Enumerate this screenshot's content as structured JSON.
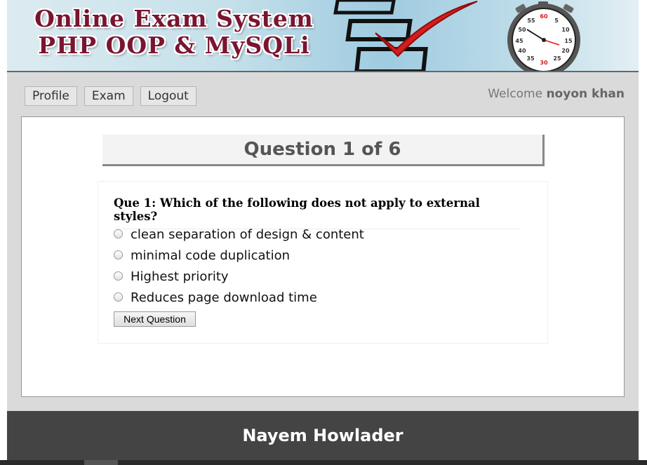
{
  "header": {
    "title_line1": "Online Exam System",
    "title_line2": "PHP OOP & MySQLi",
    "stopwatch_numbers": [
      "60",
      "5",
      "10",
      "15",
      "20",
      "25",
      "30",
      "35",
      "40",
      "45",
      "50",
      "55"
    ]
  },
  "menu": {
    "items": [
      {
        "label": "Profile"
      },
      {
        "label": "Exam"
      },
      {
        "label": "Logout"
      }
    ]
  },
  "welcome": {
    "prefix": "Welcome",
    "username": "noyon khan"
  },
  "question": {
    "heading": "Question 1 of 6",
    "text": "Que 1: Which of the following does not apply to external styles?",
    "options": [
      "clean separation of design & content",
      "minimal code duplication",
      "Highest priority",
      "Reduces page download time"
    ],
    "next_label": "Next Question"
  },
  "footer": {
    "text": "Nayem Howlader"
  },
  "colors": {
    "title_red": "#7a1530",
    "footer_bg": "#444444",
    "page_bg": "#dadada",
    "checkmark_red": "#d51d1d"
  }
}
